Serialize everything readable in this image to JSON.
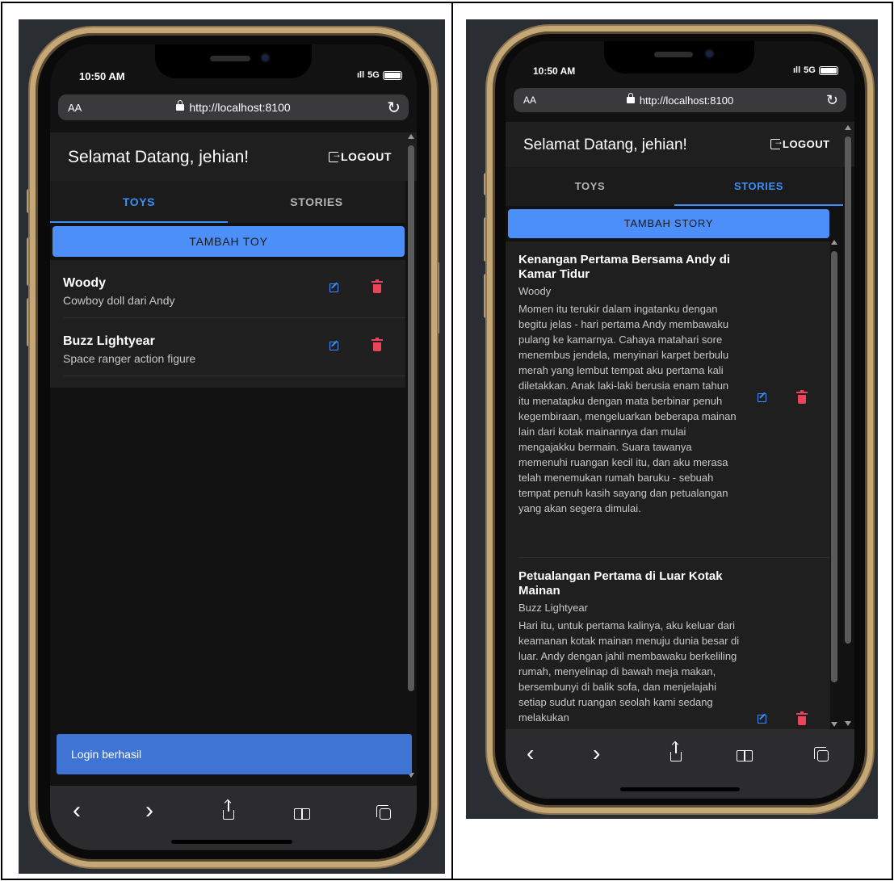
{
  "status_bar": {
    "time": "10:50 AM",
    "network": "5G"
  },
  "browser": {
    "text_size_label": "AA",
    "url": "http://localhost:8100",
    "reload_glyph": "↻"
  },
  "toolbar": {
    "back": "‹",
    "forward": "›"
  },
  "left": {
    "header": {
      "title": "Selamat Datang, jehian!",
      "logout_label": "LOGOUT"
    },
    "tabs": [
      {
        "label": "TOYS",
        "active": true
      },
      {
        "label": "STORIES",
        "active": false
      }
    ],
    "add_button_label": "TAMBAH TOY",
    "toys": [
      {
        "name": "Woody",
        "description": "Cowboy doll dari Andy"
      },
      {
        "name": "Buzz Lightyear",
        "description": "Space ranger action figure"
      }
    ],
    "toast": "Login berhasil"
  },
  "right": {
    "header": {
      "title": "Selamat Datang, jehian!",
      "logout_label": "LOGOUT"
    },
    "tabs": [
      {
        "label": "TOYS",
        "active": false
      },
      {
        "label": "STORIES",
        "active": true
      }
    ],
    "add_button_label": "TAMBAH STORY",
    "stories": [
      {
        "title": "Kenangan Pertama Bersama Andy di Kamar Tidur",
        "toy": "Woody",
        "body": "Momen itu terukir dalam ingatanku dengan begitu jelas - hari pertama Andy membawaku pulang ke kamarnya. Cahaya matahari sore menembus jendela, menyinari karpet berbulu merah yang lembut tempat aku pertama kali diletakkan. Anak laki-laki berusia enam tahun itu menatapku dengan mata berbinar penuh kegembiraan, mengeluarkan beberapa mainan lain dari kotak mainannya dan mulai mengajakku bermain. Suara tawanya memenuhi ruangan kecil itu, dan aku merasa telah menemukan rumah baruku - sebuah tempat penuh kasih sayang dan petualangan yang akan segera dimulai."
      },
      {
        "title": "Petualangan Pertama di Luar Kotak Mainan",
        "toy": "Buzz Lightyear",
        "body": "Hari itu, untuk pertama kalinya, aku keluar dari keamanan kotak mainan menuju dunia besar di luar. Andy dengan jahil membawaku berkeliling rumah, menyelinap di bawah meja makan, bersembunyi di balik sofa, dan menjelajahi setiap sudut ruangan seolah kami sedang melakukan"
      }
    ]
  },
  "colors": {
    "accent": "#3e8ef7",
    "button": "#4d8ff8",
    "danger": "#eb445a",
    "toast": "#3f73d4",
    "frame": "#c6a876"
  }
}
